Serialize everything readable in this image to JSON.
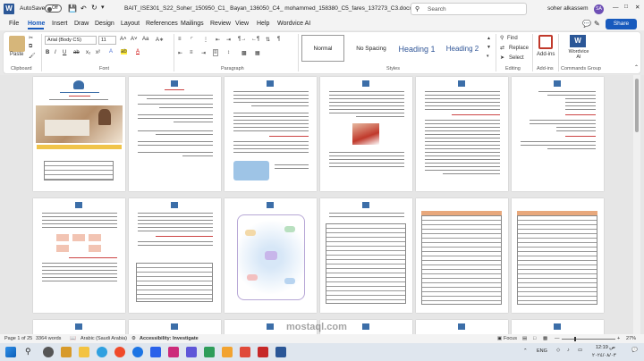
{
  "titlebar": {
    "autosave_label": "AutoSave",
    "toggle_state": "Off",
    "document_title": "BAIT_ISE301_S22_Soher_150950_C1_ Bayan_136050_C4_ mohammed_158380_C5_fares_137273_C3.docx • Saved",
    "search_placeholder": "Search",
    "user_name": "soher alkassem",
    "avatar_initials": "SA"
  },
  "menu": [
    "File",
    "Home",
    "Insert",
    "Draw",
    "Design",
    "Layout",
    "References",
    "Mailings",
    "Review",
    "View",
    "Help",
    "Wordvice AI"
  ],
  "share_label": "Share",
  "ribbon": {
    "paste_label": "Paste",
    "font_name": "Arial (Body CS)",
    "font_size": "11",
    "styles": [
      "Normal",
      "No Spacing",
      "Heading 1",
      "Heading 2"
    ],
    "find_label": "Find",
    "replace_label": "Replace",
    "select_label": "Select",
    "addins_label": "Add-ins",
    "wordvice_label": "Wordvice AI",
    "groups": [
      "Clipboard",
      "Font",
      "Paragraph",
      "Styles",
      "Editing",
      "Add-ins",
      "Commands Group"
    ]
  },
  "statusbar": {
    "page": "Page 1 of 25",
    "words": "3364 words",
    "language": "Arabic (Saudi Arabia)",
    "accessibility": "Accessibility: Investigate",
    "focus": "Focus",
    "zoom": "27%"
  },
  "taskbar": {
    "time": "12:19 ص",
    "date": "٢٠٢٤/٠٨/٠٣",
    "lang": "ENG"
  },
  "watermark": "mostaql.com"
}
